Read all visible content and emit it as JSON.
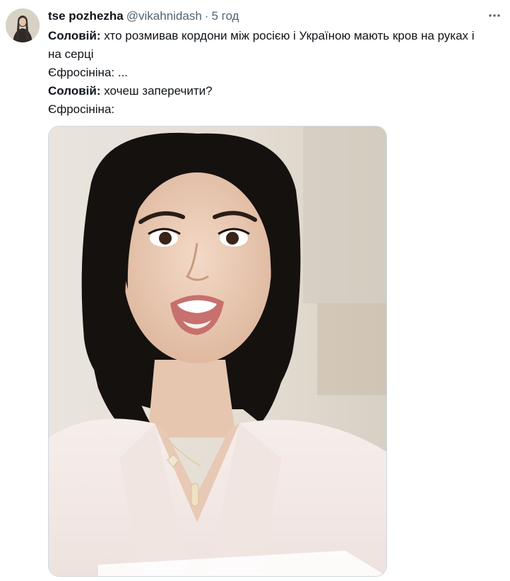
{
  "tweet": {
    "author": {
      "name": "tse pozhezha",
      "handle": "@vikahnidash",
      "separator": "·",
      "time": "5 год"
    },
    "more_icon": "more-horizontal-icon",
    "lines": [
      {
        "speaker": "Соловій:",
        "text": " хто розмивав кордони між росією і Україною мають кров на руках і на серці"
      },
      {
        "speaker": "",
        "text": "Єфросініна: ..."
      },
      {
        "speaker": "Соловій:",
        "text": " хочеш заперечити?"
      },
      {
        "speaker": "",
        "text": "Єфросініна:"
      }
    ],
    "media": {
      "type": "photo",
      "icon": "photo-woman-shocked"
    }
  },
  "colors": {
    "text_primary": "#0f1419",
    "text_secondary": "#536471",
    "border": "#cfd9de",
    "background": "#ffffff"
  }
}
